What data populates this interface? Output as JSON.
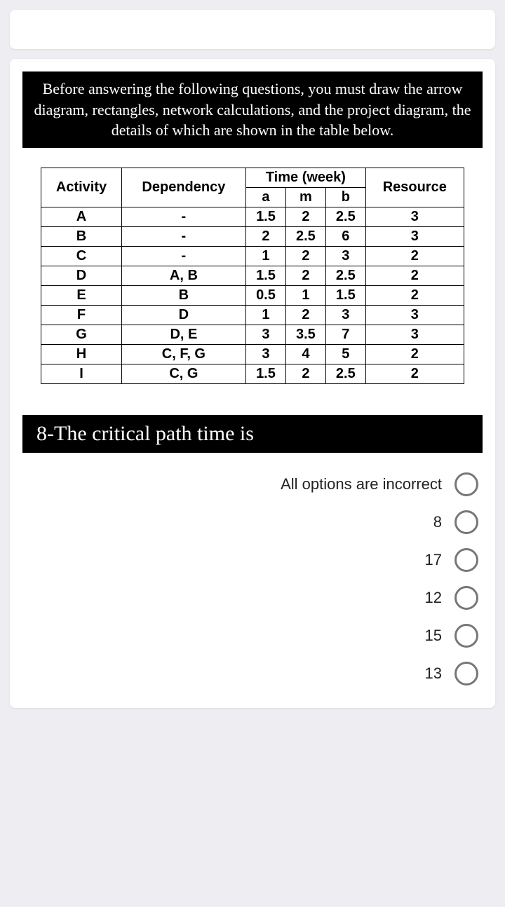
{
  "prompt_text": "Before answering the following questions, you must draw the arrow diagram, rectangles, network calculations, and the project diagram, the details of which are shown in the table below.",
  "table": {
    "header_activity": "Activity",
    "header_dependency": "Dependency",
    "header_time_group": "Time (week)",
    "header_a": "a",
    "header_m": "m",
    "header_b": "b",
    "header_resource": "Resource",
    "rows": [
      {
        "activity": "A",
        "dependency": "-",
        "a": "1.5",
        "m": "2",
        "b": "2.5",
        "resource": "3"
      },
      {
        "activity": "B",
        "dependency": "-",
        "a": "2",
        "m": "2.5",
        "b": "6",
        "resource": "3"
      },
      {
        "activity": "C",
        "dependency": "-",
        "a": "1",
        "m": "2",
        "b": "3",
        "resource": "2"
      },
      {
        "activity": "D",
        "dependency": "A, B",
        "a": "1.5",
        "m": "2",
        "b": "2.5",
        "resource": "2"
      },
      {
        "activity": "E",
        "dependency": "B",
        "a": "0.5",
        "m": "1",
        "b": "1.5",
        "resource": "2"
      },
      {
        "activity": "F",
        "dependency": "D",
        "a": "1",
        "m": "2",
        "b": "3",
        "resource": "3"
      },
      {
        "activity": "G",
        "dependency": "D, E",
        "a": "3",
        "m": "3.5",
        "b": "7",
        "resource": "3"
      },
      {
        "activity": "H",
        "dependency": "C, F, G",
        "a": "3",
        "m": "4",
        "b": "5",
        "resource": "2"
      },
      {
        "activity": "I",
        "dependency": "C, G",
        "a": "1.5",
        "m": "2",
        "b": "2.5",
        "resource": "2"
      }
    ]
  },
  "question_text": "8-The critical path time is",
  "options": [
    {
      "label": "All options are incorrect"
    },
    {
      "label": "8"
    },
    {
      "label": "17"
    },
    {
      "label": "12"
    },
    {
      "label": "15"
    },
    {
      "label": "13"
    }
  ]
}
